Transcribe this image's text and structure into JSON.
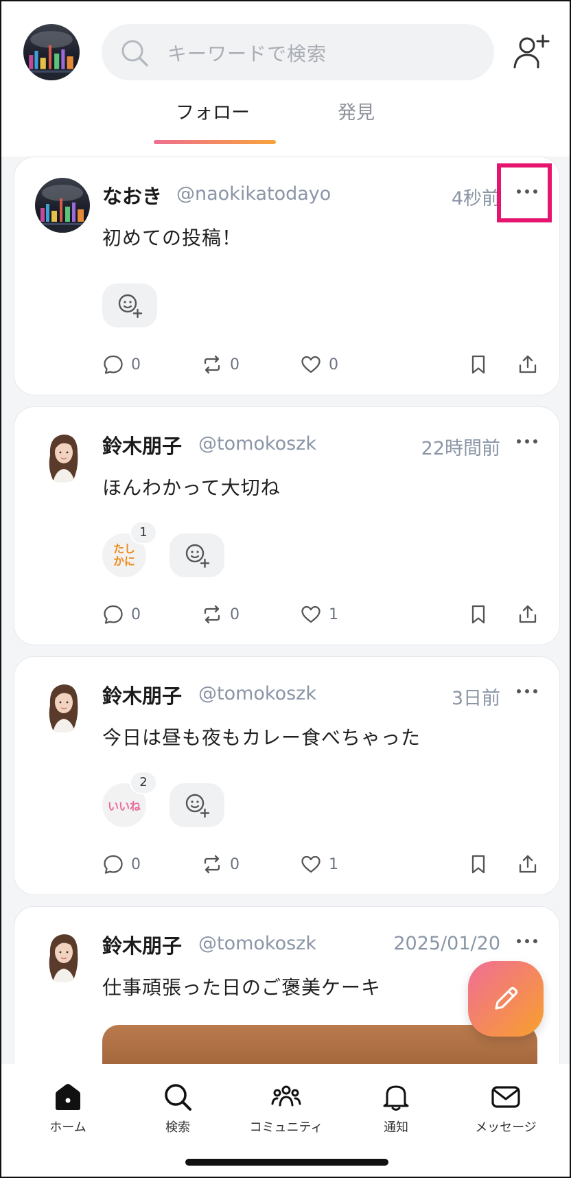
{
  "header": {
    "search_placeholder": "キーワードで検索",
    "tabs": [
      {
        "label": "フォロー",
        "active": true
      },
      {
        "label": "発見",
        "active": false
      }
    ]
  },
  "posts": [
    {
      "name": "なおき",
      "handle": "@naokikatodayo",
      "time": "4秒前",
      "content": "初めての投稿！",
      "avatar": "night-city-avatar",
      "reactions": [],
      "comments": "0",
      "reposts": "0",
      "likes": "0"
    },
    {
      "name": "鈴木朋子",
      "handle": "@tomokoszk",
      "time": "22時間前",
      "content": "ほんわかって大切ね",
      "avatar": "woman-portrait-avatar",
      "reactions": [
        {
          "stamp": "たしかに",
          "count": "1"
        }
      ],
      "comments": "0",
      "reposts": "0",
      "likes": "1"
    },
    {
      "name": "鈴木朋子",
      "handle": "@tomokoszk",
      "time": "3日前",
      "content": "今日は昼も夜もカレー食べちゃった",
      "avatar": "woman-portrait-avatar",
      "reactions": [
        {
          "stamp": "いいね",
          "count": "2"
        }
      ],
      "comments": "0",
      "reposts": "0",
      "likes": "1"
    },
    {
      "name": "鈴木朋子",
      "handle": "@tomokoszk",
      "time": "2025/01/20",
      "content": "仕事頑張った日のご褒美ケーキ",
      "avatar": "woman-portrait-avatar"
    }
  ],
  "bottom_nav": [
    {
      "label": "ホーム",
      "icon": "home-icon",
      "active": true
    },
    {
      "label": "検索",
      "icon": "search-icon",
      "active": false
    },
    {
      "label": "コミュニティ",
      "icon": "community-icon",
      "active": false
    },
    {
      "label": "通知",
      "icon": "bell-icon",
      "active": false
    },
    {
      "label": "メッセージ",
      "icon": "mail-icon",
      "active": false
    }
  ],
  "colors": {
    "accent_gradient_start": "#ef6e8f",
    "accent_gradient_end": "#f7a43b",
    "highlight": "#e5146e",
    "muted_text": "#8a95a6"
  }
}
